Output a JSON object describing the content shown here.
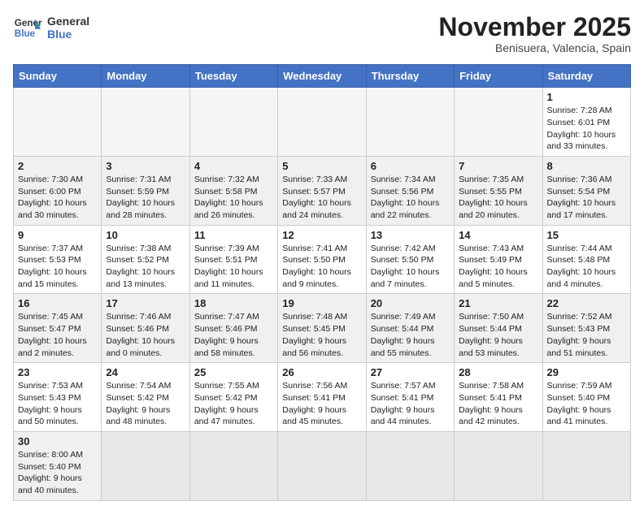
{
  "logo": {
    "line1": "General",
    "line2": "Blue"
  },
  "title": "November 2025",
  "location": "Benisuera, Valencia, Spain",
  "weekdays": [
    "Sunday",
    "Monday",
    "Tuesday",
    "Wednesday",
    "Thursday",
    "Friday",
    "Saturday"
  ],
  "weeks": [
    [
      {
        "day": "",
        "info": ""
      },
      {
        "day": "",
        "info": ""
      },
      {
        "day": "",
        "info": ""
      },
      {
        "day": "",
        "info": ""
      },
      {
        "day": "",
        "info": ""
      },
      {
        "day": "",
        "info": ""
      },
      {
        "day": "1",
        "info": "Sunrise: 7:28 AM\nSunset: 6:01 PM\nDaylight: 10 hours\nand 33 minutes."
      }
    ],
    [
      {
        "day": "2",
        "info": "Sunrise: 7:30 AM\nSunset: 6:00 PM\nDaylight: 10 hours\nand 30 minutes."
      },
      {
        "day": "3",
        "info": "Sunrise: 7:31 AM\nSunset: 5:59 PM\nDaylight: 10 hours\nand 28 minutes."
      },
      {
        "day": "4",
        "info": "Sunrise: 7:32 AM\nSunset: 5:58 PM\nDaylight: 10 hours\nand 26 minutes."
      },
      {
        "day": "5",
        "info": "Sunrise: 7:33 AM\nSunset: 5:57 PM\nDaylight: 10 hours\nand 24 minutes."
      },
      {
        "day": "6",
        "info": "Sunrise: 7:34 AM\nSunset: 5:56 PM\nDaylight: 10 hours\nand 22 minutes."
      },
      {
        "day": "7",
        "info": "Sunrise: 7:35 AM\nSunset: 5:55 PM\nDaylight: 10 hours\nand 20 minutes."
      },
      {
        "day": "8",
        "info": "Sunrise: 7:36 AM\nSunset: 5:54 PM\nDaylight: 10 hours\nand 17 minutes."
      }
    ],
    [
      {
        "day": "9",
        "info": "Sunrise: 7:37 AM\nSunset: 5:53 PM\nDaylight: 10 hours\nand 15 minutes."
      },
      {
        "day": "10",
        "info": "Sunrise: 7:38 AM\nSunset: 5:52 PM\nDaylight: 10 hours\nand 13 minutes."
      },
      {
        "day": "11",
        "info": "Sunrise: 7:39 AM\nSunset: 5:51 PM\nDaylight: 10 hours\nand 11 minutes."
      },
      {
        "day": "12",
        "info": "Sunrise: 7:41 AM\nSunset: 5:50 PM\nDaylight: 10 hours\nand 9 minutes."
      },
      {
        "day": "13",
        "info": "Sunrise: 7:42 AM\nSunset: 5:50 PM\nDaylight: 10 hours\nand 7 minutes."
      },
      {
        "day": "14",
        "info": "Sunrise: 7:43 AM\nSunset: 5:49 PM\nDaylight: 10 hours\nand 5 minutes."
      },
      {
        "day": "15",
        "info": "Sunrise: 7:44 AM\nSunset: 5:48 PM\nDaylight: 10 hours\nand 4 minutes."
      }
    ],
    [
      {
        "day": "16",
        "info": "Sunrise: 7:45 AM\nSunset: 5:47 PM\nDaylight: 10 hours\nand 2 minutes."
      },
      {
        "day": "17",
        "info": "Sunrise: 7:46 AM\nSunset: 5:46 PM\nDaylight: 10 hours\nand 0 minutes."
      },
      {
        "day": "18",
        "info": "Sunrise: 7:47 AM\nSunset: 5:46 PM\nDaylight: 9 hours\nand 58 minutes."
      },
      {
        "day": "19",
        "info": "Sunrise: 7:48 AM\nSunset: 5:45 PM\nDaylight: 9 hours\nand 56 minutes."
      },
      {
        "day": "20",
        "info": "Sunrise: 7:49 AM\nSunset: 5:44 PM\nDaylight: 9 hours\nand 55 minutes."
      },
      {
        "day": "21",
        "info": "Sunrise: 7:50 AM\nSunset: 5:44 PM\nDaylight: 9 hours\nand 53 minutes."
      },
      {
        "day": "22",
        "info": "Sunrise: 7:52 AM\nSunset: 5:43 PM\nDaylight: 9 hours\nand 51 minutes."
      }
    ],
    [
      {
        "day": "23",
        "info": "Sunrise: 7:53 AM\nSunset: 5:43 PM\nDaylight: 9 hours\nand 50 minutes."
      },
      {
        "day": "24",
        "info": "Sunrise: 7:54 AM\nSunset: 5:42 PM\nDaylight: 9 hours\nand 48 minutes."
      },
      {
        "day": "25",
        "info": "Sunrise: 7:55 AM\nSunset: 5:42 PM\nDaylight: 9 hours\nand 47 minutes."
      },
      {
        "day": "26",
        "info": "Sunrise: 7:56 AM\nSunset: 5:41 PM\nDaylight: 9 hours\nand 45 minutes."
      },
      {
        "day": "27",
        "info": "Sunrise: 7:57 AM\nSunset: 5:41 PM\nDaylight: 9 hours\nand 44 minutes."
      },
      {
        "day": "28",
        "info": "Sunrise: 7:58 AM\nSunset: 5:41 PM\nDaylight: 9 hours\nand 42 minutes."
      },
      {
        "day": "29",
        "info": "Sunrise: 7:59 AM\nSunset: 5:40 PM\nDaylight: 9 hours\nand 41 minutes."
      }
    ],
    [
      {
        "day": "30",
        "info": "Sunrise: 8:00 AM\nSunset: 5:40 PM\nDaylight: 9 hours\nand 40 minutes."
      },
      {
        "day": "",
        "info": ""
      },
      {
        "day": "",
        "info": ""
      },
      {
        "day": "",
        "info": ""
      },
      {
        "day": "",
        "info": ""
      },
      {
        "day": "",
        "info": ""
      },
      {
        "day": "",
        "info": ""
      }
    ]
  ]
}
